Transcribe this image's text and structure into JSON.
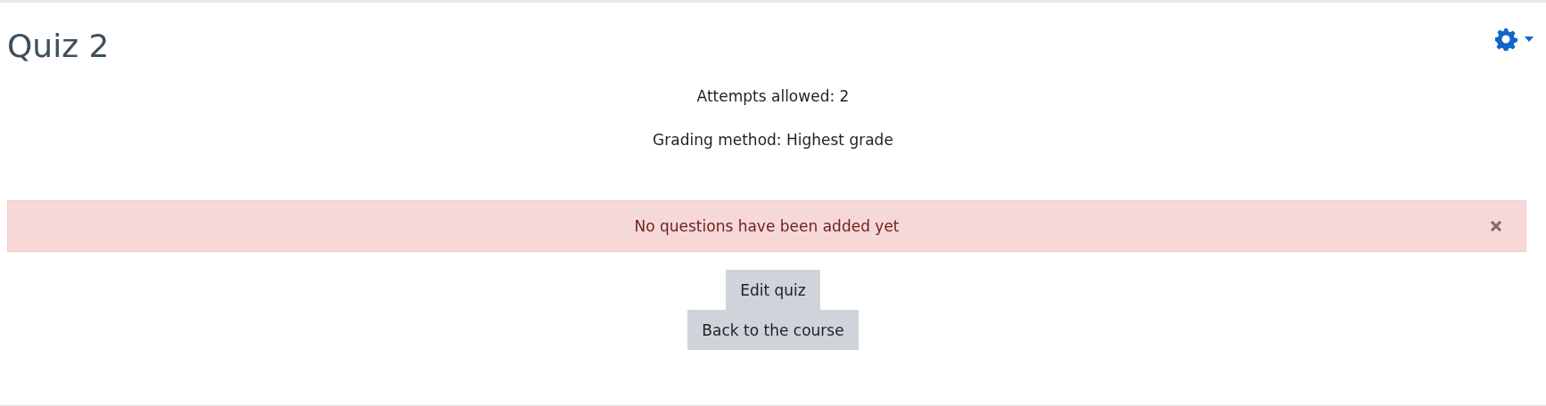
{
  "title": "Quiz 2",
  "info": [
    "Attempts allowed: 2",
    "Grading method: Highest grade"
  ],
  "alert": {
    "message": "No questions have been added yet"
  },
  "buttons": [
    "Edit quiz",
    "Back to the course"
  ]
}
